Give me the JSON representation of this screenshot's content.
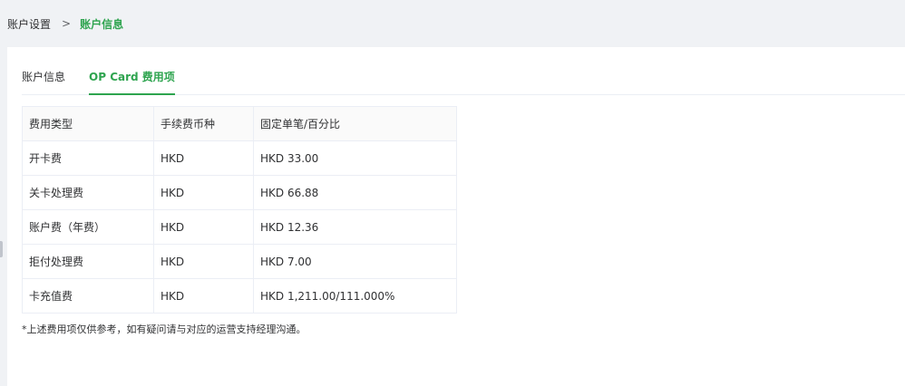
{
  "breadcrumb": {
    "parent": "账户设置",
    "separator": ">",
    "current": "账户信息"
  },
  "tabs": [
    {
      "label": "账户信息",
      "active": false
    },
    {
      "label": "OP Card 费用项",
      "active": true
    }
  ],
  "table": {
    "headers": [
      "费用类型",
      "手续费币种",
      "固定单笔/百分比"
    ],
    "rows": [
      [
        "开卡费",
        "HKD",
        "HKD 33.00"
      ],
      [
        "关卡处理费",
        "HKD",
        "HKD 66.88"
      ],
      [
        "账户费（年费）",
        "HKD",
        "HKD 12.36"
      ],
      [
        "拒付处理费",
        "HKD",
        "HKD 7.00"
      ],
      [
        "卡充值费",
        "HKD",
        "HKD 1,211.00/111.000%"
      ]
    ]
  },
  "note": "*上述费用项仅供参考，如有疑问请与对应的运营支持经理沟通。",
  "colors": {
    "accent": "#2ea44f",
    "background": "#f0f2f5",
    "border": "#ebeef5"
  }
}
